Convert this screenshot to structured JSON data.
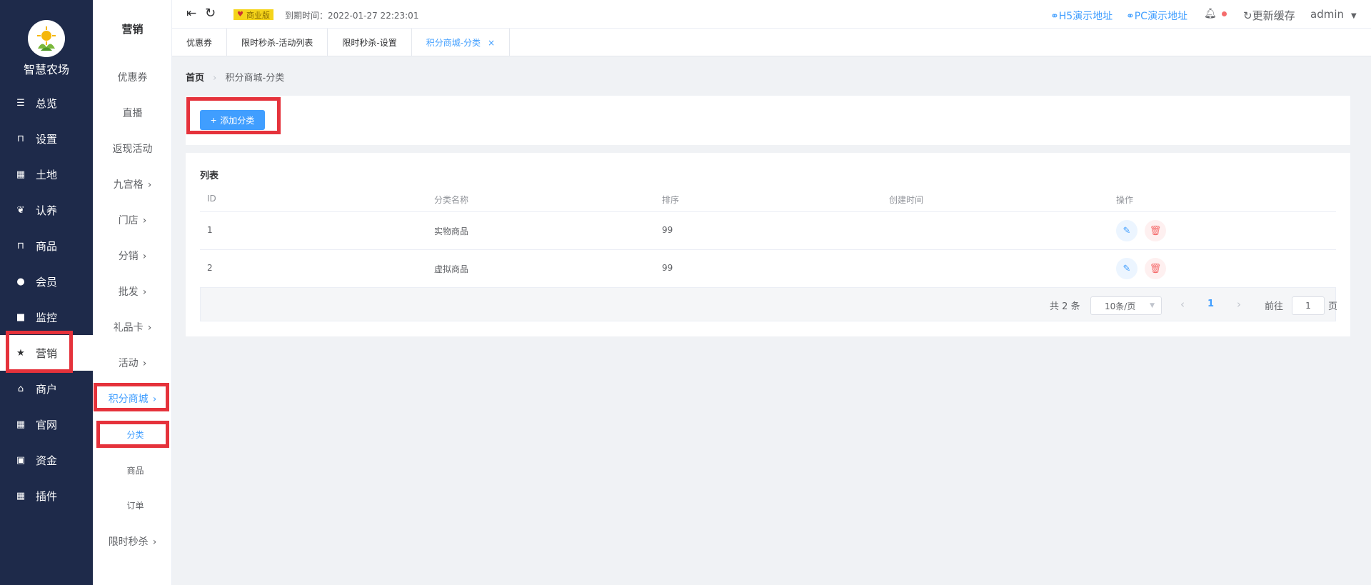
{
  "sidebar": {
    "brand": "智慧农场",
    "items": [
      {
        "label": "总览",
        "icon": "sliders-icon"
      },
      {
        "label": "设置",
        "icon": "bag-icon"
      },
      {
        "label": "土地",
        "icon": "grid-icon"
      },
      {
        "label": "认养",
        "icon": "badge-icon"
      },
      {
        "label": "商品",
        "icon": "bag-icon"
      },
      {
        "label": "会员",
        "icon": "user-icon"
      },
      {
        "label": "监控",
        "icon": "camera-icon"
      },
      {
        "label": "营销",
        "icon": "star-icon"
      },
      {
        "label": "商户",
        "icon": "store-icon"
      },
      {
        "label": "官网",
        "icon": "grid-icon"
      },
      {
        "label": "资金",
        "icon": "money-icon"
      },
      {
        "label": "插件",
        "icon": "grid-icon"
      }
    ]
  },
  "submenu": {
    "title": "营销",
    "items": [
      {
        "label": "优惠券"
      },
      {
        "label": "直播"
      },
      {
        "label": "返现活动"
      },
      {
        "label": "九宫格"
      },
      {
        "label": "门店"
      },
      {
        "label": "分销"
      },
      {
        "label": "批发"
      },
      {
        "label": "礼品卡"
      },
      {
        "label": "活动"
      },
      {
        "label": "积分商城"
      },
      {
        "label": "分类"
      },
      {
        "label": "商品"
      },
      {
        "label": "订单"
      },
      {
        "label": "限时秒杀"
      }
    ]
  },
  "header": {
    "edition": "商业版",
    "expire": "到期时间：2022-01-27 22:23:01",
    "h5_link": "H5演示地址",
    "pc_link": "PC演示地址",
    "refresh": "更新缓存",
    "user": "admin"
  },
  "tabs": [
    {
      "label": "优惠券"
    },
    {
      "label": "限时秒杀-活动列表"
    },
    {
      "label": "限时秒杀-设置"
    },
    {
      "label": "积分商城-分类"
    }
  ],
  "breadcrumb": {
    "home": "首页",
    "current": "积分商城-分类"
  },
  "toolbar": {
    "add_label": "添加分类"
  },
  "list": {
    "title": "列表",
    "columns": [
      "ID",
      "分类名称",
      "排序",
      "创建时间",
      "操作"
    ],
    "rows": [
      {
        "id": "1",
        "name": "实物商品",
        "sort": "99",
        "created": ""
      },
      {
        "id": "2",
        "name": "虚拟商品",
        "sort": "99",
        "created": ""
      }
    ]
  },
  "pagination": {
    "total": "共 2 条",
    "page_size": "10条/页",
    "current_page": "1",
    "goto_label": "前往",
    "goto_value": "1",
    "page_suffix": "页"
  },
  "colors": {
    "sidebar": "#1e2a4a",
    "accent": "#409eff",
    "highlight": "#e5323b",
    "danger": "#f56c6c",
    "badge": "#f5d41a"
  }
}
